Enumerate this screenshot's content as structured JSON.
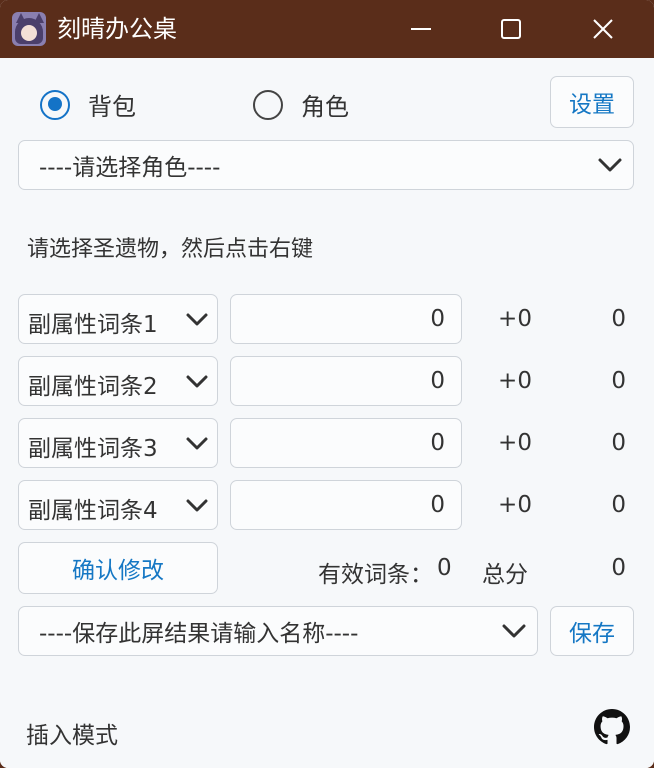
{
  "window": {
    "title": "刻晴办公桌",
    "icon": "app-character-icon",
    "controls": [
      "minimize-icon",
      "maximize-icon",
      "close-icon"
    ]
  },
  "mode": {
    "options": [
      {
        "label": "背包",
        "checked": true
      },
      {
        "label": "角色",
        "checked": false
      }
    ],
    "settings_label": "设置"
  },
  "character_select": {
    "value": "----请选择角色----"
  },
  "hint": "请选择圣遗物，然后点击右键",
  "substats": [
    {
      "label": "副属性词条1",
      "value": "0",
      "bonus": "+0",
      "score": "0"
    },
    {
      "label": "副属性词条2",
      "value": "0",
      "bonus": "+0",
      "score": "0"
    },
    {
      "label": "副属性词条3",
      "value": "0",
      "bonus": "+0",
      "score": "0"
    },
    {
      "label": "副属性词条4",
      "value": "0",
      "bonus": "+0",
      "score": "0"
    }
  ],
  "confirm_label": "确认修改",
  "summary": {
    "effective_label": "有效词条：",
    "effective_value": "0",
    "total_label": "总分",
    "total_value": "0"
  },
  "save_select": {
    "value": "----保存此屏结果请输入名称----"
  },
  "save_label": "保存",
  "footer": {
    "mode_text": "插入模式",
    "icon": "github-icon"
  },
  "colors": {
    "titlebar": "#5a2d1a",
    "accent": "#1473c7",
    "background": "#f6f8fa"
  }
}
